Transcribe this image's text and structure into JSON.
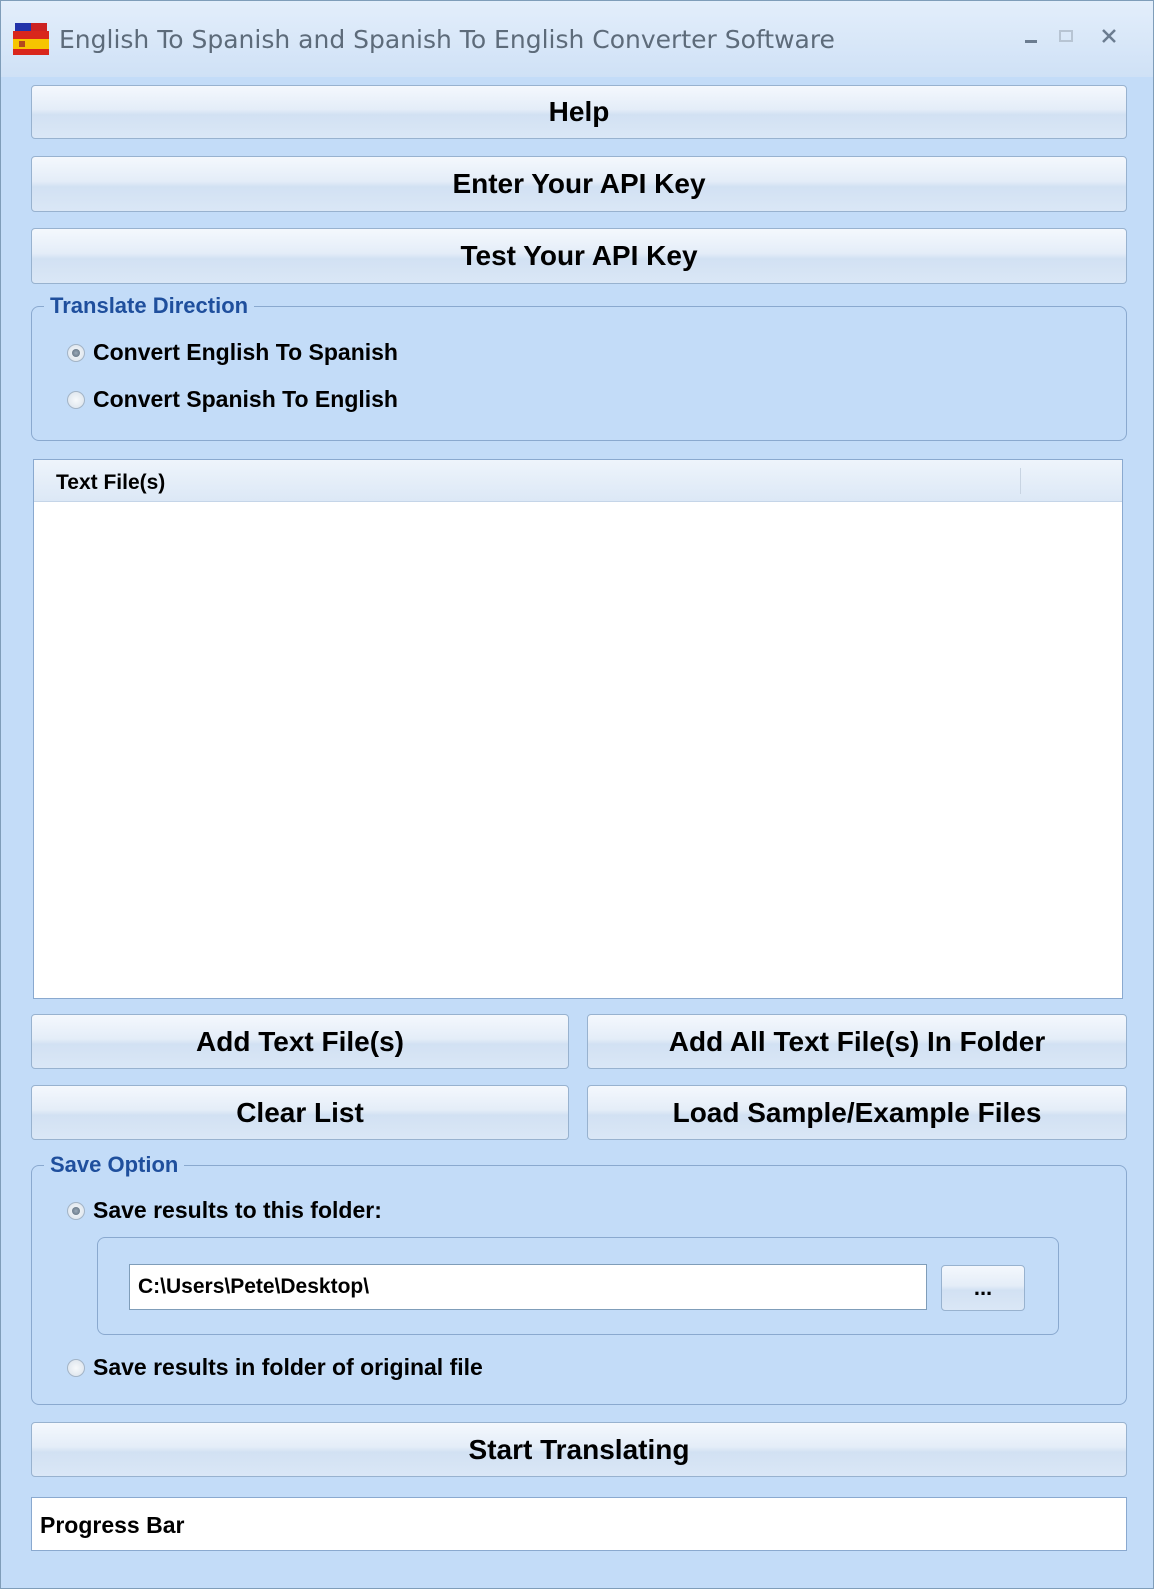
{
  "window": {
    "title": "English To Spanish and Spanish To English Converter Software",
    "icon": "spanish-flag-icon"
  },
  "buttons": {
    "help": "Help",
    "enter_api_key": "Enter Your API Key",
    "test_api_key": "Test Your API Key",
    "add_text_files": "Add Text File(s)",
    "add_all_in_folder": "Add All Text File(s) In Folder",
    "clear_list": "Clear List",
    "load_sample": "Load Sample/Example Files",
    "browse": "...",
    "start_translating": "Start Translating"
  },
  "translate_direction": {
    "label": "Translate Direction",
    "options": [
      {
        "label": "Convert English To Spanish",
        "checked": true
      },
      {
        "label": "Convert Spanish To English",
        "checked": false
      }
    ]
  },
  "file_list": {
    "columns": [
      "Text File(s)"
    ],
    "rows": []
  },
  "save_option": {
    "label": "Save Option",
    "options": [
      {
        "label": "Save results to this folder:",
        "checked": true
      },
      {
        "label": "Save results in folder of original file",
        "checked": false
      }
    ],
    "folder_path": "C:\\Users\\Pete\\Desktop\\"
  },
  "progress": {
    "label": "Progress Bar"
  }
}
